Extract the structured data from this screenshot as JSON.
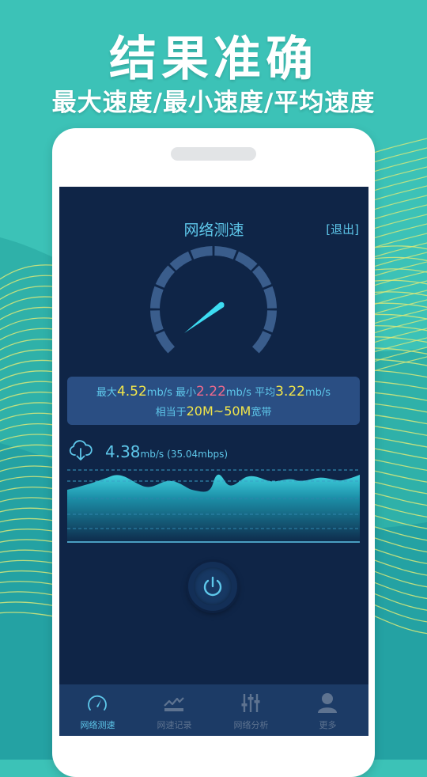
{
  "promo": {
    "title": "结果准确",
    "subtitle": "最大速度/最小速度/平均速度"
  },
  "app": {
    "title": "网络测速",
    "exit_label": "[退出]"
  },
  "stats": {
    "max_label": "最大",
    "max_value": "4.52",
    "min_label": "最小",
    "min_value": "2.22",
    "avg_label": "平均",
    "avg_value": "3.22",
    "unit": "mb/s",
    "equiv_prefix": "相当于",
    "equiv_range": "20M~50M",
    "equiv_suffix": "宽带"
  },
  "current": {
    "speed": "4.38",
    "unit": "mb/s",
    "mbps": "(35.04mbps)"
  },
  "tabs": [
    {
      "label": "网络测速",
      "icon": "speedometer-icon",
      "active": true
    },
    {
      "label": "网速记录",
      "icon": "chart-icon",
      "active": false
    },
    {
      "label": "网络分析",
      "icon": "sliders-icon",
      "active": false
    },
    {
      "label": "更多",
      "icon": "user-icon",
      "active": false
    }
  ],
  "colors": {
    "background": "#3cc2b7",
    "screen": "#0f2547",
    "accent": "#5ec7ea",
    "max_value": "#f2e64a",
    "min_value": "#f06a8c",
    "wave_lines": "#d8e87a"
  }
}
